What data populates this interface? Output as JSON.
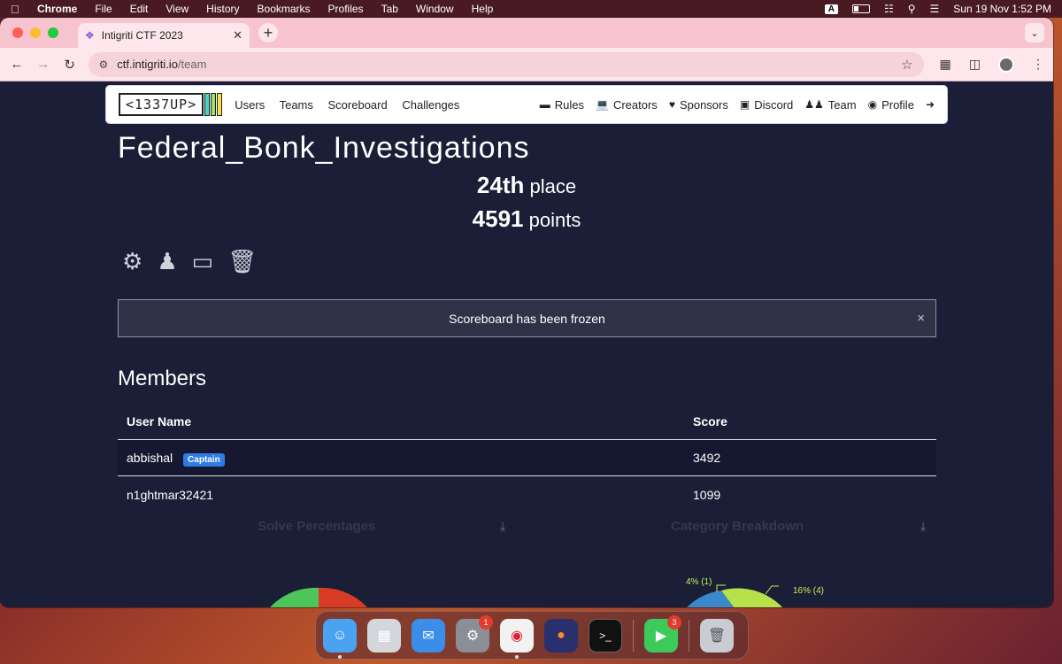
{
  "menubar": {
    "app": "Chrome",
    "items": [
      "File",
      "Edit",
      "View",
      "History",
      "Bookmarks",
      "Profiles",
      "Tab",
      "Window",
      "Help"
    ],
    "input_source": "A",
    "clock": "Sun 19 Nov  1:52 PM"
  },
  "browser": {
    "tab_title": "Intigriti CTF 2023",
    "url_host": "ctf.intigriti.io",
    "url_path": "/team"
  },
  "site": {
    "logo_text": "<1337UP>",
    "nav_left": [
      "Users",
      "Teams",
      "Scoreboard",
      "Challenges"
    ],
    "nav_right": [
      {
        "label": "Rules",
        "icon": "ruler-icon"
      },
      {
        "label": "Creators",
        "icon": "laptop-icon"
      },
      {
        "label": "Sponsors",
        "icon": "heart-icon"
      },
      {
        "label": "Discord",
        "icon": "discord-icon"
      },
      {
        "label": "Team",
        "icon": "users-icon"
      },
      {
        "label": "Profile",
        "icon": "user-circle-icon"
      }
    ]
  },
  "team": {
    "name": "Federal_Bonk_Investigations",
    "place_value": "24th",
    "place_label": "place",
    "points_value": "4591",
    "points_label": "points"
  },
  "alert": {
    "message": "Scoreboard has been frozen",
    "close": "×"
  },
  "members": {
    "heading": "Members",
    "columns": [
      "User Name",
      "Score"
    ],
    "rows": [
      {
        "name": "abbishal",
        "badge": "Captain",
        "score": "3492"
      },
      {
        "name": "n1ghtmar32421",
        "badge": "",
        "score": "1099"
      }
    ]
  },
  "charts": {
    "solve_title": "Solve Percentages",
    "category_title": "Category Breakdown",
    "category_labels": [
      "4% (1)",
      "16% (4)"
    ]
  },
  "dock": {
    "badges": {
      "settings": "1",
      "facetime": "3"
    }
  }
}
